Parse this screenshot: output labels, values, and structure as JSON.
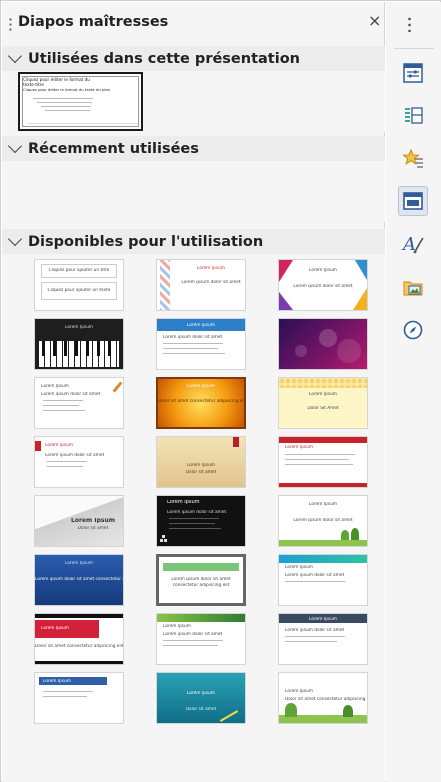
{
  "panel": {
    "title": "Diapos maîtresses",
    "close_label": "×"
  },
  "sections": {
    "used": {
      "title": "Utilisées dans cette présentation"
    },
    "recent": {
      "title": "Récemment utilisées"
    },
    "available": {
      "title": "Disponibles pour l'utilisation"
    }
  },
  "used_slide": {
    "title": "Cliquez pour éditer le format du",
    "title2": "texte-titre",
    "body": "Cliquez pour éditer le format du texte du plan"
  },
  "templates": [
    {
      "title": "Cliquez pour ajouter un titre",
      "sub": "Cliquez pour ajouter un texte"
    },
    {
      "title": "Lorem Ipsum",
      "sub": "Lorem ipsum dolor sit amet"
    },
    {
      "title": "Lorem Ipsum",
      "sub": "Lorem ipsum dolor sit amet"
    },
    {
      "title": "Lorem Ipsum",
      "sub": ""
    },
    {
      "title": "Lorem Ipsum",
      "sub": "Lorem ipsum dolor sit amet"
    },
    {
      "title": "",
      "sub": ""
    },
    {
      "title": "Lorem Ipsum",
      "sub": "Lorem ipsum dolor sit amet"
    },
    {
      "title": "Lorem Ipsum",
      "sub": "Dolor sit amet consectetur adipiscing elit"
    },
    {
      "title": "Lorem Ipsum",
      "sub": "Dolor Sit Amet"
    },
    {
      "title": "Lorem Ipsum",
      "sub": "Lorem ipsum dolor sit amet"
    },
    {
      "title": "Lorem Ipsum",
      "sub": "Dolor sit amet"
    },
    {
      "title": "Lorem Ipsum",
      "sub": ""
    },
    {
      "title": "Lorem Ipsum",
      "sub": "Dolor sit amet"
    },
    {
      "title": "Lorem Ipsum",
      "sub": "Lorem ipsum dolor sit amet"
    },
    {
      "title": "Lorem Ipsum",
      "sub": "Lorem ipsum dolor sit amet"
    },
    {
      "title": "Lorem Ipsum",
      "sub": "Lorem ipsum dolor sit amet consectetur adipiscing elit"
    },
    {
      "title": "Lorem ipsum dolor sit amet",
      "sub": "consectetur adipiscing elit"
    },
    {
      "title": "Lorem Ipsum",
      "sub": "Lorem ipsum dolor sit amet"
    },
    {
      "title": "Lorem Ipsum",
      "sub": "Dolor sit amet consectetur adipiscing elit"
    },
    {
      "title": "Lorem Ipsum",
      "sub": "Lorem ipsum dolor sit amet"
    },
    {
      "title": "Lorem Ipsum",
      "sub": "Lorem ipsum dolor sit amet"
    },
    {
      "title": "Lorem Ipsum",
      "sub": ""
    },
    {
      "title": "Lorem Ipsum",
      "sub": "Dolor sit amet"
    },
    {
      "title": "Lorem Ipsum",
      "sub": "Dolor sit amet consectetur adipiscing elit"
    }
  ],
  "rail": {
    "items": [
      {
        "icon": "properties-icon"
      },
      {
        "icon": "styles-icon"
      },
      {
        "icon": "gallery-icon"
      },
      {
        "icon": "master-slides-icon"
      },
      {
        "icon": "animation-icon"
      },
      {
        "icon": "slide-transition-icon"
      },
      {
        "icon": "navigator-icon"
      }
    ]
  },
  "colors": {
    "accent": "#3a6ea5",
    "header_bg": "#ececec",
    "panel_bg": "#f5f5f5"
  }
}
